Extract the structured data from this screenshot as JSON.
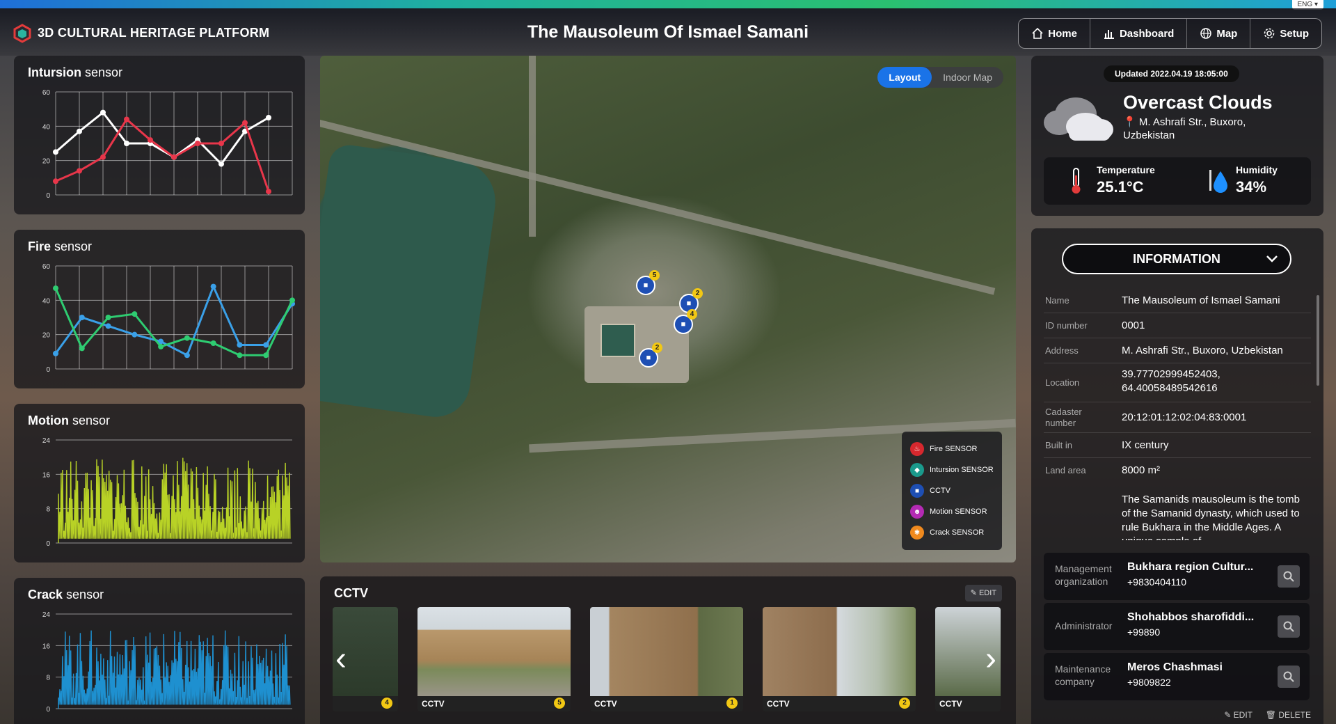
{
  "lang": "ENG",
  "header": {
    "brand": "3D CULTURAL HERITAGE PLATFORM",
    "title": "The Mausoleum Of Ismael Samani",
    "nav": [
      {
        "label": "Home",
        "icon": "home-icon"
      },
      {
        "label": "Dashboard",
        "icon": "bar-chart-icon"
      },
      {
        "label": "Map",
        "icon": "globe-icon"
      },
      {
        "label": "Setup",
        "icon": "gear-icon"
      }
    ]
  },
  "sensors": {
    "intrusion": {
      "title_bold": "Intursion",
      "title_light": " sensor"
    },
    "fire": {
      "title_bold": "Fire",
      "title_light": " sensor"
    },
    "motion": {
      "title_bold": "Motion",
      "title_light": " sensor"
    },
    "crack": {
      "title_bold": "Crack",
      "title_light": " sensor"
    }
  },
  "chart_data": [
    {
      "type": "line",
      "title": "Intursion sensor",
      "ylim": [
        0,
        60
      ],
      "yticks": [
        0,
        20,
        40,
        60
      ],
      "x": [
        0,
        1,
        2,
        3,
        4,
        5,
        6,
        7,
        8,
        9,
        10
      ],
      "series": [
        {
          "color": "#ffffff",
          "values": [
            25,
            37,
            48,
            30,
            30,
            22,
            32,
            18,
            37,
            45,
            null
          ]
        },
        {
          "color": "#e8364a",
          "values": [
            8,
            14,
            22,
            44,
            32,
            22,
            30,
            30,
            42,
            2,
            null
          ]
        }
      ]
    },
    {
      "type": "line",
      "title": "Fire sensor",
      "ylim": [
        0,
        60
      ],
      "yticks": [
        0,
        20,
        40,
        60
      ],
      "x": [
        0,
        1,
        2,
        3,
        4,
        5,
        6,
        7,
        8,
        9,
        10
      ],
      "series": [
        {
          "color": "#3aa0e8",
          "values": [
            9,
            30,
            25,
            20,
            16,
            8,
            48,
            14,
            14,
            38
          ]
        },
        {
          "color": "#2ecc71",
          "values": [
            47,
            12,
            30,
            32,
            13,
            18,
            15,
            8,
            8,
            40
          ]
        }
      ]
    },
    {
      "type": "area",
      "title": "Motion sensor",
      "ylim": [
        0,
        24
      ],
      "yticks": [
        0,
        8,
        16,
        24
      ],
      "color": "#b8d226",
      "min": 2,
      "max": 20
    },
    {
      "type": "area",
      "title": "Crack sensor",
      "ylim": [
        0,
        24
      ],
      "yticks": [
        0,
        8,
        16,
        24
      ],
      "color": "#1e90d0",
      "min": 2,
      "max": 20
    }
  ],
  "map": {
    "toggle_on": "Layout",
    "toggle_off": "Indoor Map",
    "markers": [
      {
        "num": "5",
        "icon": "cctv-icon"
      },
      {
        "num": "2",
        "icon": "cctv-icon"
      },
      {
        "num": "4",
        "icon": "cctv-icon"
      },
      {
        "num": "2",
        "icon": "cctv-icon"
      }
    ],
    "legend": [
      {
        "label": "Fire SENSOR",
        "color": "#d6282e",
        "icon": "fire-icon"
      },
      {
        "label": "Intursion SENSOR",
        "color": "#1a9a8c",
        "icon": "shield-icon"
      },
      {
        "label": "CCTV",
        "color": "#1e4fb4",
        "icon": "camera-icon"
      },
      {
        "label": "Motion SENSOR",
        "color": "#b42ab4",
        "icon": "person-icon"
      },
      {
        "label": "Crack SENSOR",
        "color": "#f08a1e",
        "icon": "crack-icon"
      }
    ]
  },
  "cctv": {
    "title": "CCTV",
    "edit_label": "EDIT",
    "items": [
      {
        "caption": "",
        "badge": "4"
      },
      {
        "caption": "CCTV",
        "badge": "5"
      },
      {
        "caption": "CCTV",
        "badge": "1"
      },
      {
        "caption": "CCTV",
        "badge": "2"
      },
      {
        "caption": "CCTV",
        "badge": ""
      }
    ]
  },
  "weather": {
    "updated": "Updated 2022.04.19 18:05:00",
    "condition": "Overcast Clouds",
    "address": "M. Ashrafi Str., Buxoro, Uzbekistan",
    "temp_label": "Temperature",
    "temp_value": "25.1°C",
    "hum_label": "Humidity",
    "hum_value": "34%"
  },
  "info": {
    "button": "INFORMATION",
    "rows": [
      {
        "k": "Name",
        "v": "The Mausoleum of Ismael Samani"
      },
      {
        "k": "ID number",
        "v": "0001"
      },
      {
        "k": "Address",
        "v": "M. Ashrafi Str., Buxoro, Uzbekistan"
      },
      {
        "k": "Location",
        "v": "39.77702999452403,",
        "v2": "64.40058489542616"
      },
      {
        "k": "Cadaster",
        "k2": "number",
        "v": "20:12:01:12:02:04:83:0001"
      },
      {
        "k": "Built in",
        "v": "IX century"
      },
      {
        "k": "Land area",
        "v": "8000 m²"
      }
    ],
    "description": "The Samanids mausoleum is the tomb of the Samanid dynasty, which used to rule Bukhara in the Middle Ages. A unique sample of",
    "cards": [
      {
        "k": "Management",
        "k2": "organization",
        "v": "Bukhara region Cultur...",
        "p": "+9830404110"
      },
      {
        "k": "Administrator",
        "k2": "",
        "v": "Shohabbos sharofiddi...",
        "p": "+99890"
      },
      {
        "k": "Maintenance",
        "k2": "company",
        "v": "Meros Chashmasi",
        "p": "+9809822"
      }
    ],
    "edit": "EDIT",
    "delete": "DELETE"
  }
}
